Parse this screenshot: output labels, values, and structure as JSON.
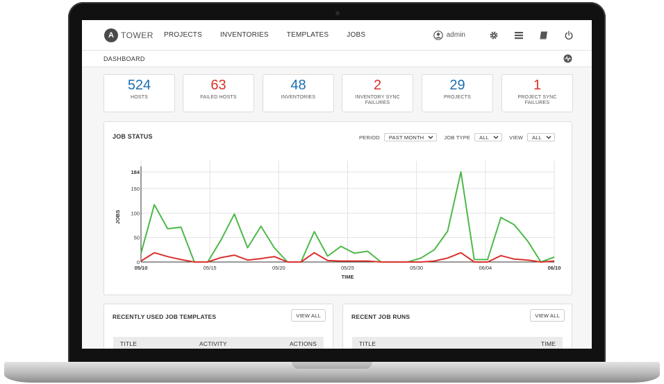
{
  "brand": {
    "logo_letter": "A",
    "name": "TOWER"
  },
  "nav": {
    "links": [
      "PROJECTS",
      "INVENTORIES",
      "TEMPLATES",
      "JOBS"
    ],
    "username": "admin"
  },
  "breadcrumb": "DASHBOARD",
  "counts": [
    {
      "value": "524",
      "label": "HOSTS",
      "color": "#1a6fb3"
    },
    {
      "value": "63",
      "label": "FAILED HOSTS",
      "color": "#d9312b"
    },
    {
      "value": "48",
      "label": "INVENTORIES",
      "color": "#1a6fb3"
    },
    {
      "value": "2",
      "label": "INVENTORY SYNC FAILURES",
      "color": "#d9312b"
    },
    {
      "value": "29",
      "label": "PROJECTS",
      "color": "#1a6fb3"
    },
    {
      "value": "1",
      "label": "PROJECT SYNC FAILURES",
      "color": "#d9312b"
    }
  ],
  "job_status": {
    "title": "JOB STATUS",
    "filters": {
      "period_label": "PERIOD",
      "period_value": "PAST MONTH",
      "job_type_label": "JOB TYPE",
      "job_type_value": "ALL",
      "view_label": "VIEW",
      "view_value": "ALL"
    }
  },
  "chart_data": {
    "type": "line",
    "xlabel": "TIME",
    "ylabel": "JOBS",
    "ylim": [
      0,
      184
    ],
    "yticks": [
      0,
      50,
      100,
      150,
      184
    ],
    "xticks": [
      "05/10",
      "05/15",
      "05/20",
      "05/25",
      "05/30",
      "06/04",
      "06/10"
    ],
    "grid": true,
    "series": [
      {
        "color": "#4cb848",
        "values": [
          18,
          117,
          68,
          71,
          0,
          0,
          45,
          98,
          29,
          73,
          29,
          0,
          0,
          62,
          12,
          32,
          18,
          22,
          0,
          0,
          0,
          8,
          25,
          63,
          184,
          5,
          5,
          91,
          76,
          43,
          0,
          10
        ]
      },
      {
        "color": "#d9312b",
        "values": [
          2,
          19,
          11,
          5,
          0,
          0,
          9,
          14,
          4,
          7,
          11,
          0,
          0,
          19,
          3,
          2,
          2,
          2,
          0,
          0,
          0,
          0,
          2,
          8,
          19,
          0,
          0,
          13,
          6,
          4,
          0,
          2
        ]
      }
    ]
  },
  "recent_templates": {
    "title": "RECENTLY USED JOB TEMPLATES",
    "view_all": "VIEW ALL",
    "columns": [
      "TITLE",
      "ACTIVITY",
      "ACTIONS"
    ]
  },
  "recent_jobs": {
    "title": "RECENT JOB RUNS",
    "view_all": "VIEW ALL",
    "columns": [
      "TITLE",
      "TIME"
    ]
  }
}
